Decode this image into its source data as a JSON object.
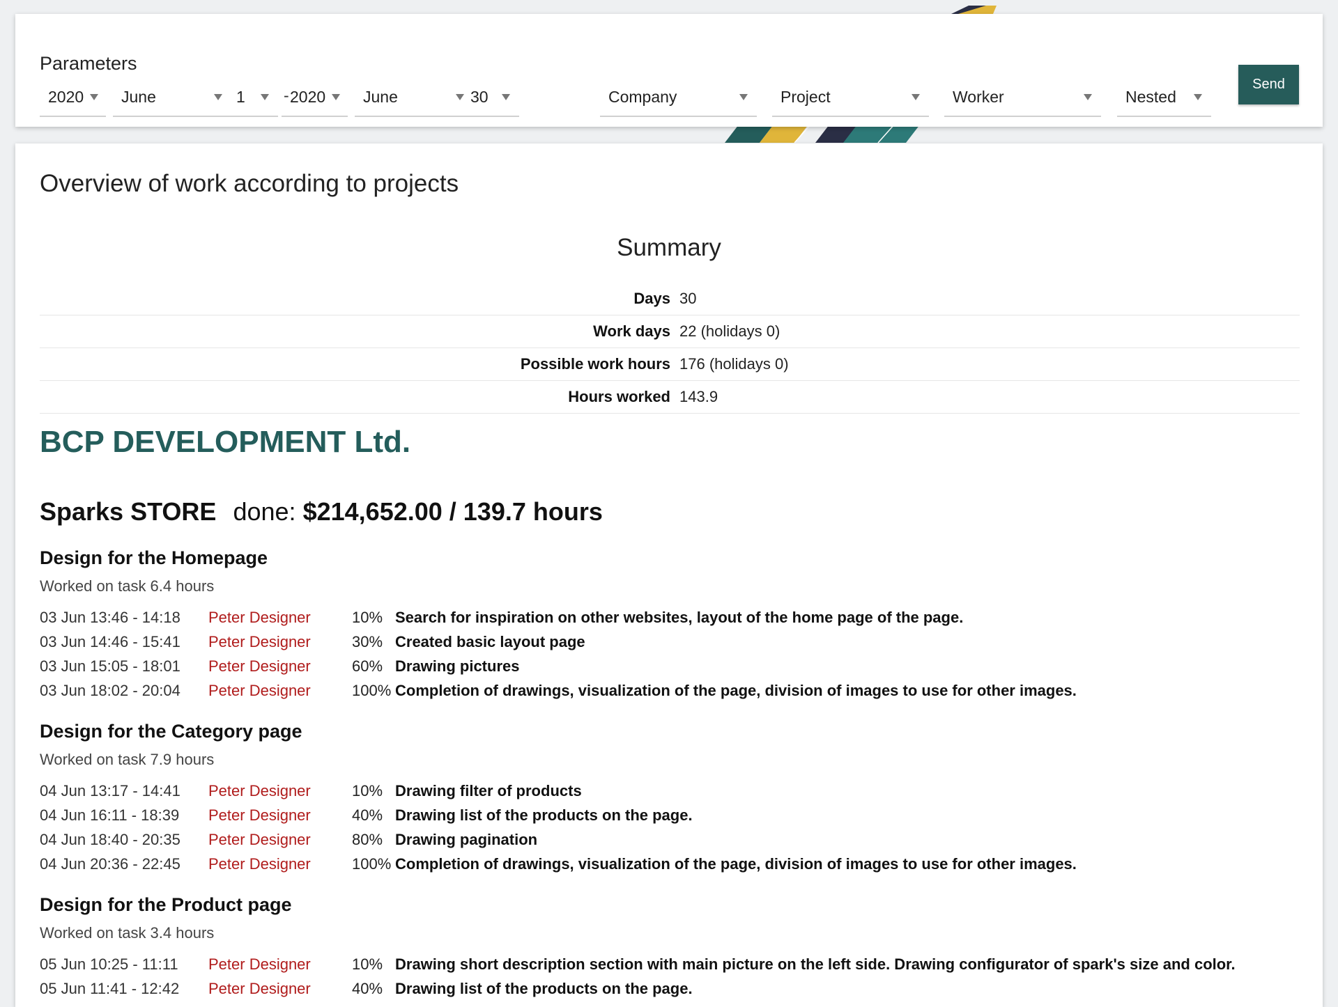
{
  "params": {
    "title": "Parameters",
    "from_year": "2020",
    "from_month": "June",
    "from_day": "1",
    "separator": "-",
    "to_year": "2020",
    "to_month": "June",
    "to_day": "30",
    "company": "Company",
    "project": "Project",
    "worker": "Worker",
    "mode": "Nested",
    "send_label": "Send"
  },
  "report": {
    "title": "Overview of work according to projects",
    "summary_title": "Summary",
    "summary": [
      {
        "label": "Days",
        "value": "30"
      },
      {
        "label": "Work days",
        "value": "22 (holidays 0)"
      },
      {
        "label": "Possible work hours",
        "value": "176 (holidays 0)"
      },
      {
        "label": "Hours worked",
        "value": "143.9"
      }
    ],
    "company": "BCP DEVELOPMENT Ltd.",
    "project": {
      "name": "Sparks STORE",
      "done_label": "done:",
      "amount": "$214,652.00 / 139.7 hours"
    },
    "tasks": [
      {
        "title": "Design for the Homepage",
        "subtitle": "Worked on task 6.4 hours",
        "entries": [
          {
            "time": "03 Jun 13:46 - 14:18",
            "worker": "Peter Designer",
            "pct": "10%",
            "desc": "Search for inspiration on other websites, layout of the home page of the page."
          },
          {
            "time": "03 Jun 14:46 - 15:41",
            "worker": "Peter Designer",
            "pct": "30%",
            "desc": "Created basic layout page"
          },
          {
            "time": "03 Jun 15:05 - 18:01",
            "worker": "Peter Designer",
            "pct": "60%",
            "desc": "Drawing pictures"
          },
          {
            "time": "03 Jun 18:02 - 20:04",
            "worker": "Peter Designer",
            "pct": "100%",
            "desc": "Completion of drawings, visualization of the page, division of images to use for other images."
          }
        ]
      },
      {
        "title": "Design for the Category page",
        "subtitle": "Worked on task 7.9 hours",
        "entries": [
          {
            "time": "04 Jun 13:17 - 14:41",
            "worker": "Peter Designer",
            "pct": "10%",
            "desc": "Drawing filter of products"
          },
          {
            "time": "04 Jun 16:11 - 18:39",
            "worker": "Peter Designer",
            "pct": "40%",
            "desc": "Drawing list of the products on the page."
          },
          {
            "time": "04 Jun 18:40 - 20:35",
            "worker": "Peter Designer",
            "pct": "80%",
            "desc": "Drawing pagination"
          },
          {
            "time": "04 Jun 20:36 - 22:45",
            "worker": "Peter Designer",
            "pct": "100%",
            "desc": "Completion of drawings, visualization of the page, division of images to use for other images."
          }
        ]
      },
      {
        "title": "Design for the Product page",
        "subtitle": "Worked on task 3.4 hours",
        "entries": [
          {
            "time": "05 Jun 10:25 - 11:11",
            "worker": "Peter Designer",
            "pct": "10%",
            "desc": "Drawing short description section with main picture on the left side. Drawing configurator of spark's size and color."
          },
          {
            "time": "05 Jun 11:41 - 12:42",
            "worker": "Peter Designer",
            "pct": "40%",
            "desc": "Drawing list of the products on the page."
          }
        ]
      }
    ]
  },
  "colors": {
    "accent": "#265c5a",
    "worker_red": "#b01c1c",
    "background": "#eef0f2"
  }
}
